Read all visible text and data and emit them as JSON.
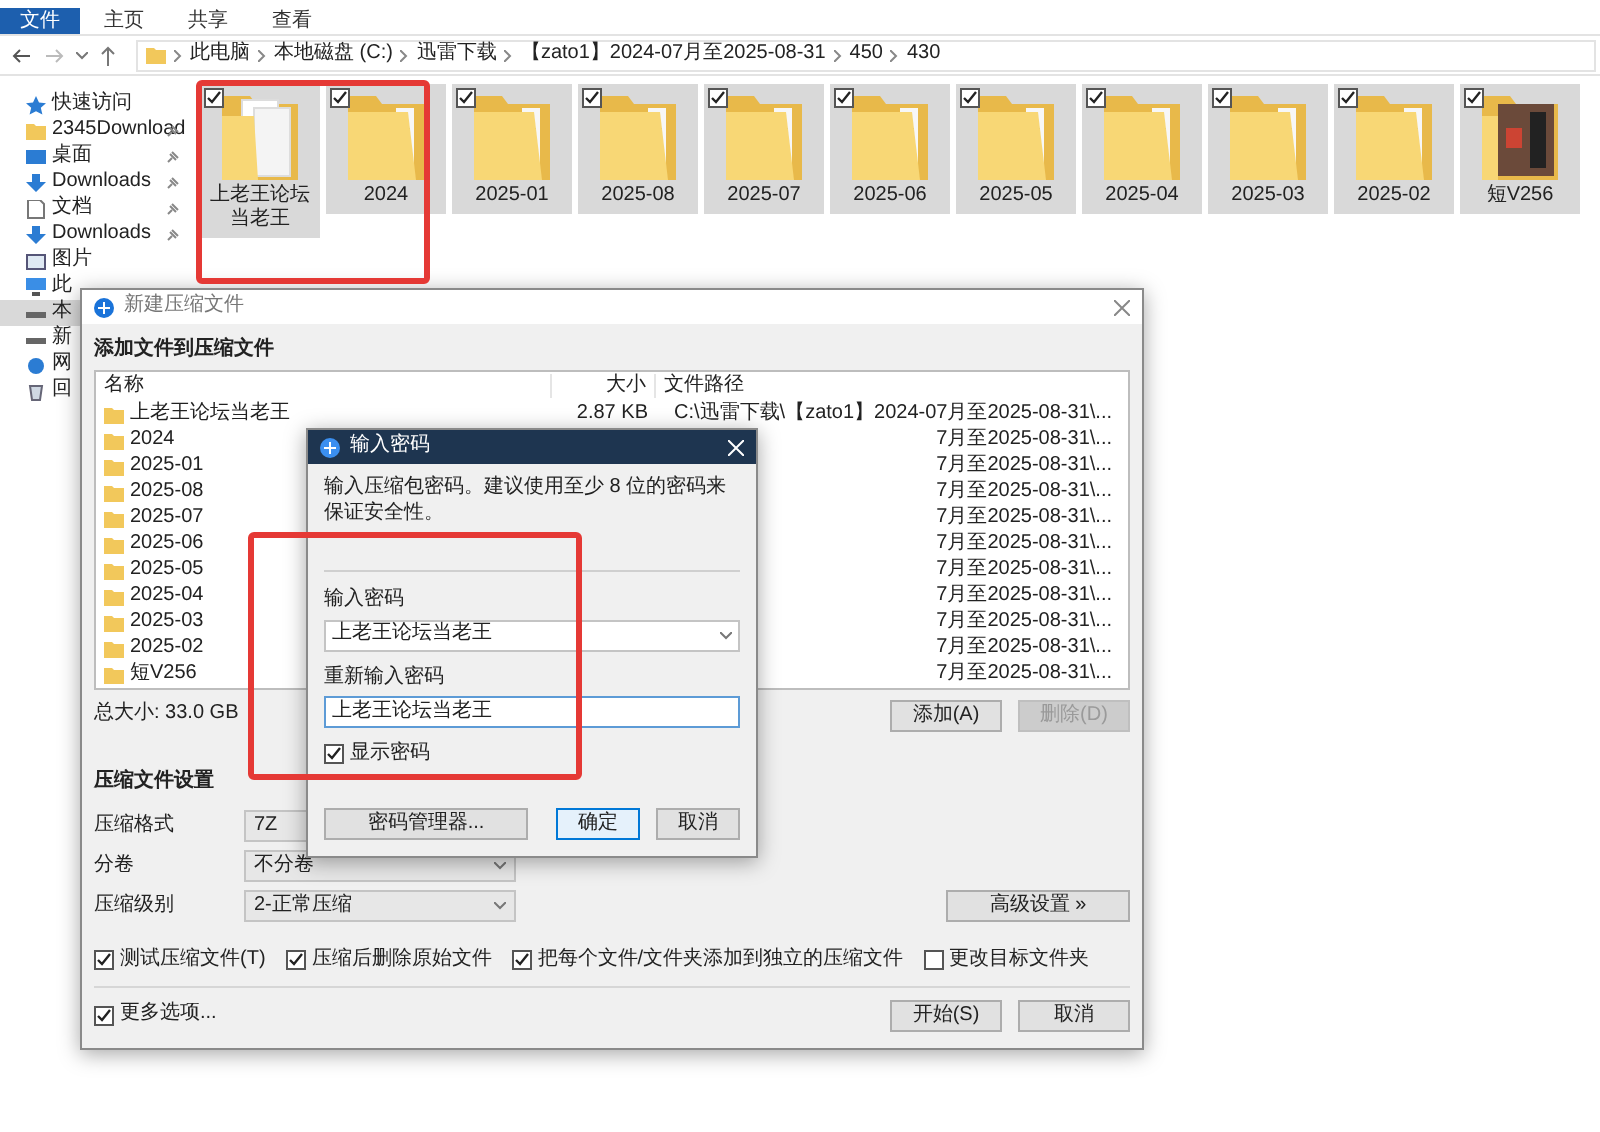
{
  "explorer": {
    "ribbon_tabs": [
      {
        "label": "文件",
        "selected": true
      },
      {
        "label": "主页",
        "selected": false
      },
      {
        "label": "共享",
        "selected": false
      },
      {
        "label": "查看",
        "selected": false
      }
    ],
    "breadcrumb": [
      "此电脑",
      "本地磁盘 (C:)",
      "迅雷下载",
      "【zato1】2024-07月至2025-08-31",
      "450",
      "430"
    ],
    "sidebar": [
      {
        "label": "快速访问",
        "kind": "star",
        "pinned": false,
        "selected": false
      },
      {
        "label": "2345Download",
        "kind": "folder",
        "pinned": true,
        "selected": false
      },
      {
        "label": "桌面",
        "kind": "desktop",
        "pinned": true,
        "selected": false
      },
      {
        "label": "Downloads",
        "kind": "download",
        "pinned": true,
        "selected": false
      },
      {
        "label": "文档",
        "kind": "document",
        "pinned": true,
        "selected": false
      },
      {
        "label": "Downloads",
        "kind": "download",
        "pinned": true,
        "selected": false
      },
      {
        "label": "图片",
        "kind": "picture",
        "pinned": false,
        "selected": false
      },
      {
        "label": "此",
        "kind": "pc",
        "pinned": false,
        "selected": false
      },
      {
        "label": "本",
        "kind": "drive",
        "pinned": false,
        "selected": true
      },
      {
        "label": "新",
        "kind": "drive",
        "pinned": false,
        "selected": false
      },
      {
        "label": "网",
        "kind": "network",
        "pinned": false,
        "selected": false
      },
      {
        "label": "回",
        "kind": "recycle",
        "pinned": false,
        "selected": false
      }
    ],
    "items": [
      {
        "label": "上老王论坛当老王",
        "kind": "papers",
        "checked": true,
        "selected": true
      },
      {
        "label": "2024",
        "kind": "folder",
        "checked": true,
        "selected": true
      },
      {
        "label": "2025-01",
        "kind": "folder",
        "checked": true,
        "selected": true
      },
      {
        "label": "2025-08",
        "kind": "folder",
        "checked": true,
        "selected": true
      },
      {
        "label": "2025-07",
        "kind": "folder",
        "checked": true,
        "selected": true
      },
      {
        "label": "2025-06",
        "kind": "folder",
        "checked": true,
        "selected": true
      },
      {
        "label": "2025-05",
        "kind": "folder",
        "checked": true,
        "selected": true
      },
      {
        "label": "2025-04",
        "kind": "folder",
        "checked": true,
        "selected": true
      },
      {
        "label": "2025-03",
        "kind": "folder",
        "checked": true,
        "selected": true
      },
      {
        "label": "2025-02",
        "kind": "folder",
        "checked": true,
        "selected": true
      },
      {
        "label": "短V256",
        "kind": "photo",
        "checked": true,
        "selected": true
      }
    ]
  },
  "archive_dialog": {
    "title": "新建压缩文件",
    "heading": "添加文件到压缩文件",
    "columns": [
      "名称",
      "大小",
      "文件路径"
    ],
    "rows": [
      {
        "name": "上老王论坛当老王",
        "size": "2.87 KB",
        "path": "C:\\迅雷下载\\【zato1】2024-07月至2025-08-31\\..."
      },
      {
        "name": "2024",
        "path": "7月至2025-08-31\\..."
      },
      {
        "name": "2025-01",
        "path": "7月至2025-08-31\\..."
      },
      {
        "name": "2025-08",
        "path": "7月至2025-08-31\\..."
      },
      {
        "name": "2025-07",
        "path": "7月至2025-08-31\\..."
      },
      {
        "name": "2025-06",
        "path": "7月至2025-08-31\\..."
      },
      {
        "name": "2025-05",
        "path": "7月至2025-08-31\\..."
      },
      {
        "name": "2025-04",
        "path": "7月至2025-08-31\\..."
      },
      {
        "name": "2025-03",
        "path": "7月至2025-08-31\\..."
      },
      {
        "name": "2025-02",
        "path": "7月至2025-08-31\\..."
      },
      {
        "name": "短V256",
        "path": "7月至2025-08-31\\..."
      }
    ],
    "total": "总大小: 33.0 GB",
    "list_buttons": [
      {
        "label": "添加(A)",
        "disabled": false
      },
      {
        "label": "删除(D)",
        "disabled": true
      }
    ],
    "settings_heading": "压缩文件设置",
    "fields": [
      {
        "label": "压缩格式",
        "value": "7Z"
      },
      {
        "label": "分卷",
        "value": "不分卷"
      },
      {
        "label": "压缩级别",
        "value": "2-正常压缩"
      }
    ],
    "advanced_button": "高级设置 »",
    "options": [
      {
        "label": "测试压缩文件(T)",
        "checked": true
      },
      {
        "label": "压缩后删除原始文件",
        "checked": true
      },
      {
        "label": "把每个文件/文件夹添加到独立的压缩文件",
        "checked": true
      },
      {
        "label": "更改目标文件夹",
        "checked": false
      }
    ],
    "more_options": {
      "label": "更多选项...",
      "checked": true
    },
    "footer_buttons": [
      "开始(S)",
      "取消"
    ]
  },
  "password_dialog": {
    "title": "输入密码",
    "message": "输入压缩包密码。建议使用至少 8 位的密码来保证安全性。",
    "password_label": "输入密码",
    "password": "上老王论坛当老王",
    "confirm_label": "重新输入密码",
    "confirm": "上老王论坛当老王",
    "show_password": {
      "label": "显示密码",
      "checked": true
    },
    "buttons": [
      {
        "label": "密码管理器...",
        "default": false
      },
      {
        "label": "确定",
        "default": true
      },
      {
        "label": "取消",
        "default": false
      }
    ]
  },
  "annotation_frames": [
    {
      "color": "#e53935"
    },
    {
      "color": "#e53935"
    }
  ]
}
